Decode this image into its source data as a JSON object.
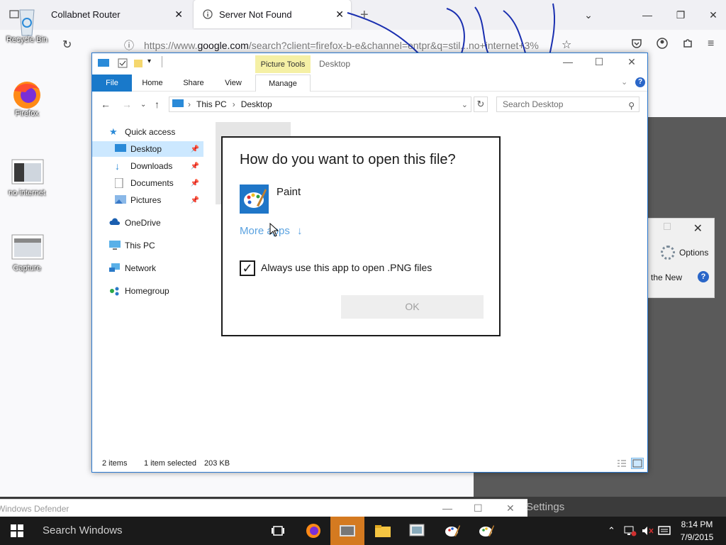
{
  "browser": {
    "tabs": [
      {
        "label": "Collabnet Router"
      },
      {
        "label": "Server Not Found"
      }
    ],
    "url_prefix": "https://www.",
    "url_domain": "google.com",
    "url_suffix": "/search?client=firefox-b-e&channel=entpr&q=stil...no+internet+3%"
  },
  "desktop": {
    "icons": [
      {
        "label": "Recycle Bin"
      },
      {
        "label": "Firefox"
      },
      {
        "label": "no internet"
      },
      {
        "label": "Capture"
      }
    ]
  },
  "explorer": {
    "quick_access_toolbar": [
      "properties-icon",
      "new-folder-icon"
    ],
    "picture_tools": "Picture Tools",
    "title": "Desktop",
    "ribbon_tabs": [
      "File",
      "Home",
      "Share",
      "View",
      "Manage"
    ],
    "breadcrumb": [
      "This PC",
      "Desktop"
    ],
    "search_placeholder": "Search Desktop",
    "nav": [
      {
        "label": "Quick access"
      },
      {
        "label": "Desktop"
      },
      {
        "label": "Downloads"
      },
      {
        "label": "Documents"
      },
      {
        "label": "Pictures"
      },
      {
        "label": "OneDrive"
      },
      {
        "label": "This PC"
      },
      {
        "label": "Network"
      },
      {
        "label": "Homegroup"
      }
    ],
    "status_items": "2 items",
    "status_selected": "1 item selected",
    "status_size": "203 KB"
  },
  "dialog": {
    "heading": "How do you want to open this file?",
    "app": "Paint",
    "more_apps": "More apps",
    "more_apps_arrow": "↓",
    "checkbox_label": "Always use this app to open .PNG files",
    "checkbox_checked": true,
    "ok": "OK"
  },
  "right_dialog": {
    "options": "Options",
    "new_text": "the New",
    "help": "?"
  },
  "defender": {
    "title": "Windows Defender",
    "settings": "Settings"
  },
  "taskbar": {
    "search_placeholder": "Search Windows",
    "time": "8:14 PM",
    "date": "7/9/2015"
  },
  "colors": {
    "accent": "#1979ca",
    "selection": "#cce8ff",
    "taskbar": "#1a1a1a",
    "active_task": "#d47a20",
    "picture_tools": "#f5f0a5"
  }
}
